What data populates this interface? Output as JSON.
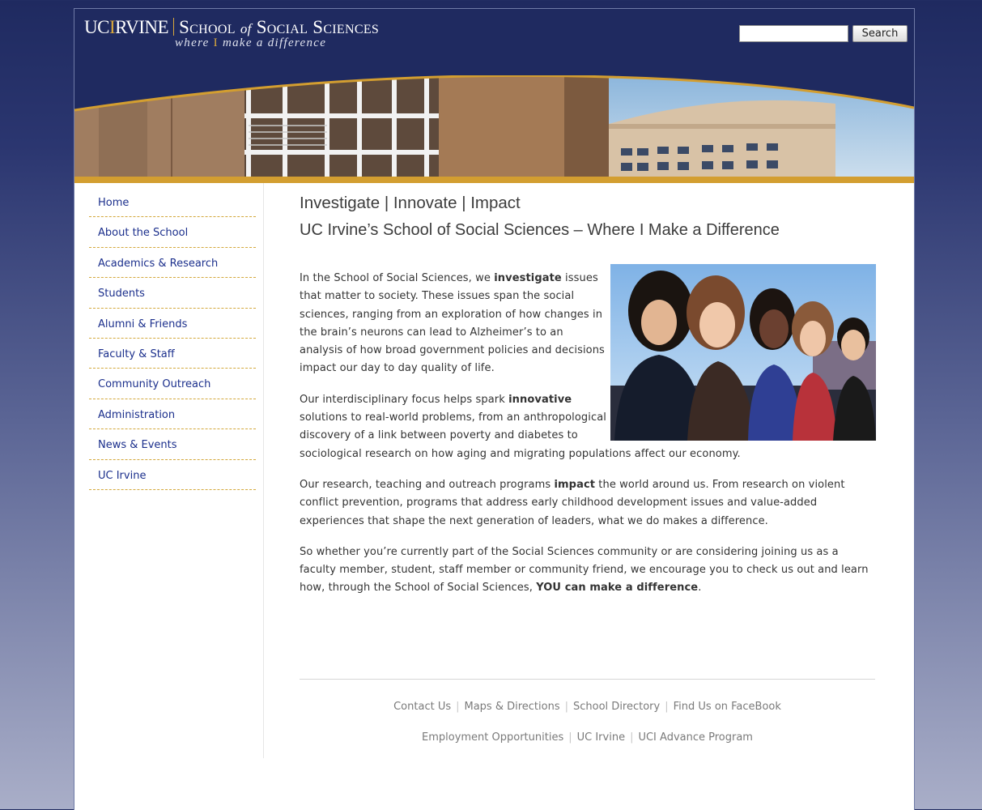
{
  "logo": {
    "uci_prefix": "UC",
    "uci_i": "I",
    "uci_rest": "RVINE",
    "school_1": "School ",
    "school_of": "of",
    "school_2": " Social Sciences",
    "tagline_1": "where ",
    "tagline_i": "I",
    "tagline_2": " make a difference"
  },
  "search": {
    "button_label": "Search",
    "value": "",
    "placeholder": ""
  },
  "nav": {
    "items": [
      {
        "label": "Home"
      },
      {
        "label": "About the School"
      },
      {
        "label": "Academics & Research"
      },
      {
        "label": "Students"
      },
      {
        "label": "Alumni & Friends"
      },
      {
        "label": "Faculty & Staff"
      },
      {
        "label": "Community Outreach"
      },
      {
        "label": "Administration"
      },
      {
        "label": "News & Events"
      },
      {
        "label": "UC Irvine"
      }
    ]
  },
  "main": {
    "heading": "Investigate | Innovate | Impact",
    "subheading": "UC Irvine’s School of Social Sciences – Where I Make a Difference",
    "p1_a": "In the School of Social Sciences, we ",
    "p1_b": "investigate",
    "p1_c": " issues that matter to society.  These issues span the social sciences, ranging from an exploration of how changes in the brain’s neurons can lead to Alzheimer’s to an analysis of how broad government policies and decisions impact our day to day quality of life.",
    "p2_a": "Our interdisciplinary focus helps spark ",
    "p2_b": "innovative",
    "p2_c": " solutions to real-world problems, from an anthropological discovery of a link between poverty and diabetes to sociological research on how aging and migrating populations affect our economy.",
    "p3_a": "Our research, teaching and outreach programs ",
    "p3_b": "impact",
    "p3_c": " the world around us. From research on violent conflict prevention, programs that address early childhood development issues and value-added experiences that shape the next generation of leaders, what we do makes a difference.",
    "p4_a": "So whether you’re currently part of the Social Sciences community or are considering joining us as a faculty member, student, staff member or community friend, we encourage you to check us out and learn how, through the School of Social Sciences, ",
    "p4_b": "YOU can make a difference",
    "p4_c": "."
  },
  "footer": {
    "row1": [
      "Contact Us",
      "Maps & Directions",
      "School Directory",
      "Find Us on FaceBook"
    ],
    "row2": [
      "Employment Opportunities",
      "UC Irvine",
      "UCI Advance Program"
    ],
    "sep": "|"
  },
  "colors": {
    "navy": "#1f2a60",
    "gold": "#d39e30",
    "link": "#1b2f8c"
  }
}
